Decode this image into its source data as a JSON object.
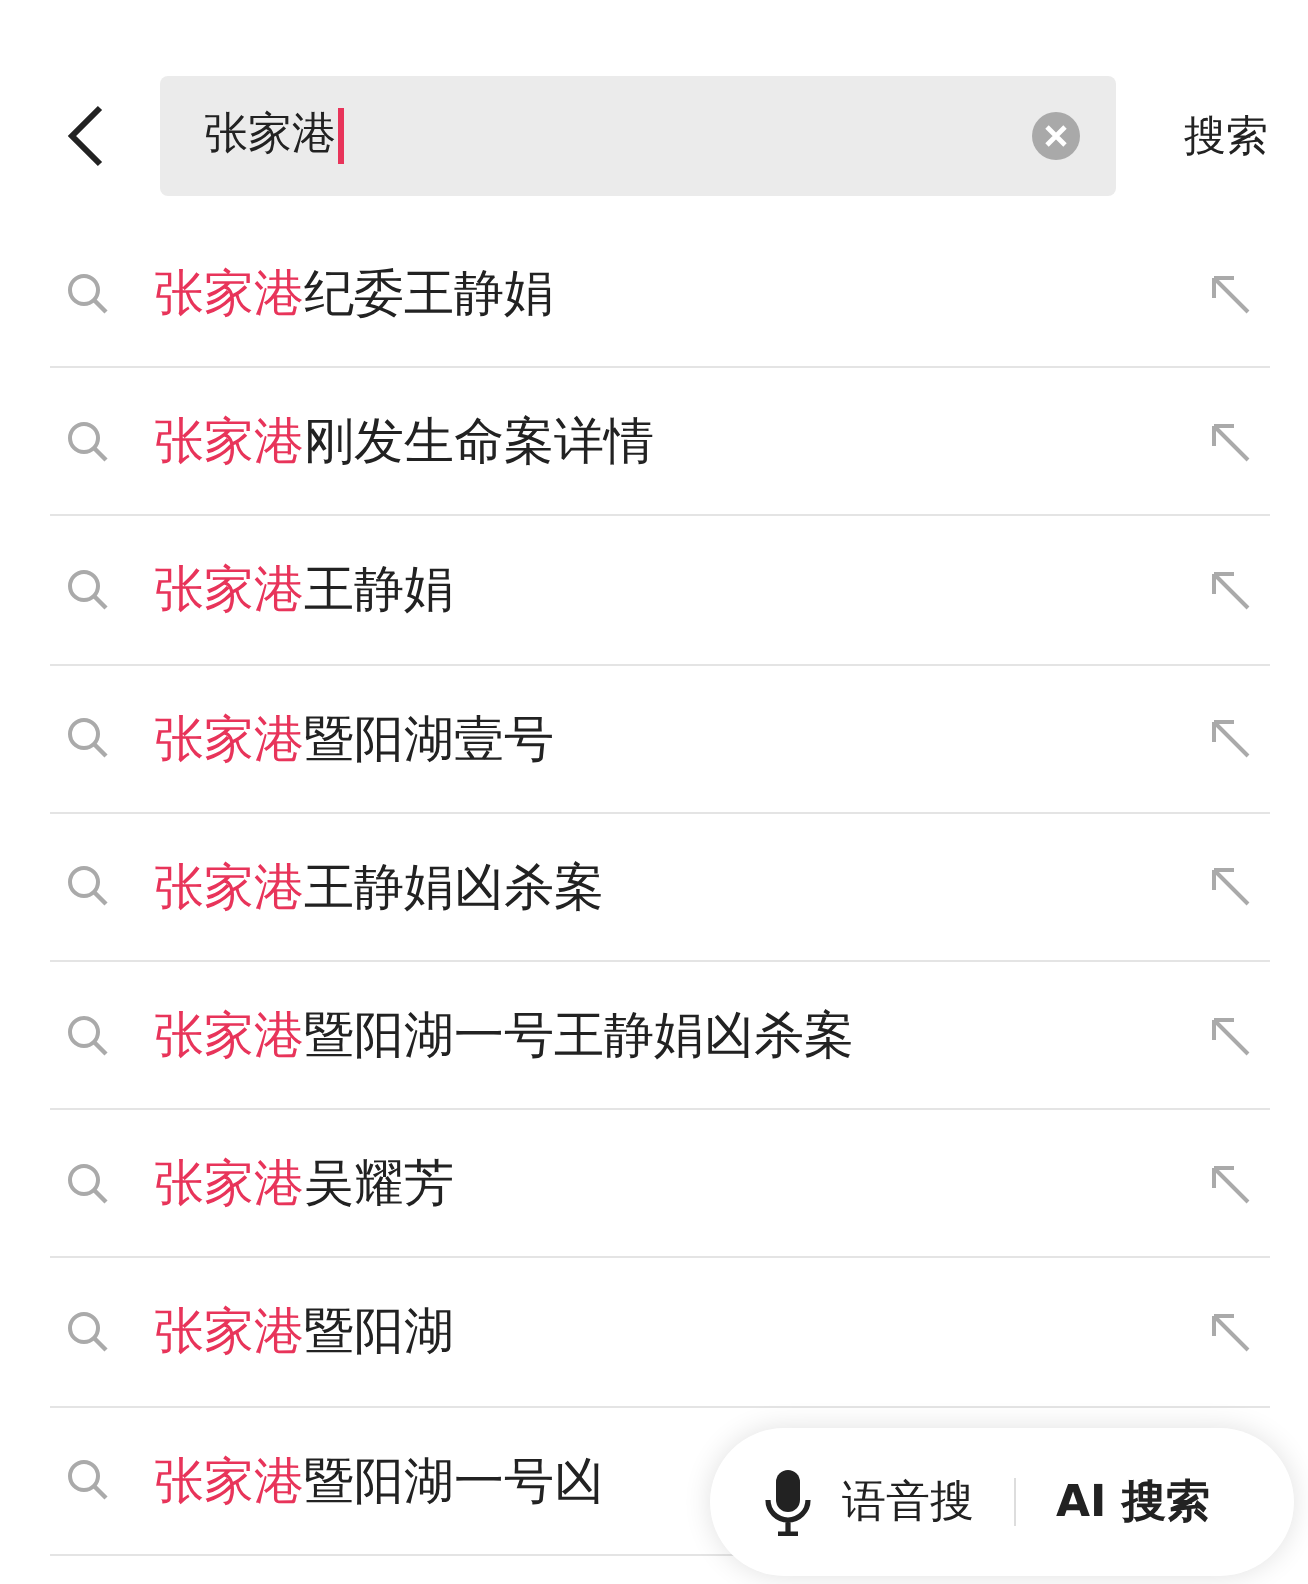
{
  "search_bar": {
    "value": "张家港",
    "search_label": "搜索"
  },
  "suggestions": [
    {
      "match": "张家港",
      "rest": "纪委王静娟",
      "fill_icon": true
    },
    {
      "match": "张家港",
      "rest": "刚发生命案详情",
      "fill_icon": true
    },
    {
      "match": "张家港",
      "rest": "王静娟",
      "fill_icon": true
    },
    {
      "match": "张家港",
      "rest": "暨阳湖壹号",
      "fill_icon": true
    },
    {
      "match": "张家港",
      "rest": "王静娟凶杀案",
      "fill_icon": true
    },
    {
      "match": "张家港",
      "rest": "暨阳湖一号王静娟凶杀案",
      "fill_icon": true
    },
    {
      "match": "张家港",
      "rest": "吴耀芳",
      "fill_icon": true
    },
    {
      "match": "张家港",
      "rest": "暨阳湖",
      "fill_icon": true
    },
    {
      "match": "张家港",
      "rest": "暨阳湖一号凶",
      "fill_icon": false
    }
  ],
  "floating_bar": {
    "voice_label": "语音搜",
    "ai_label": "AI 搜索"
  }
}
